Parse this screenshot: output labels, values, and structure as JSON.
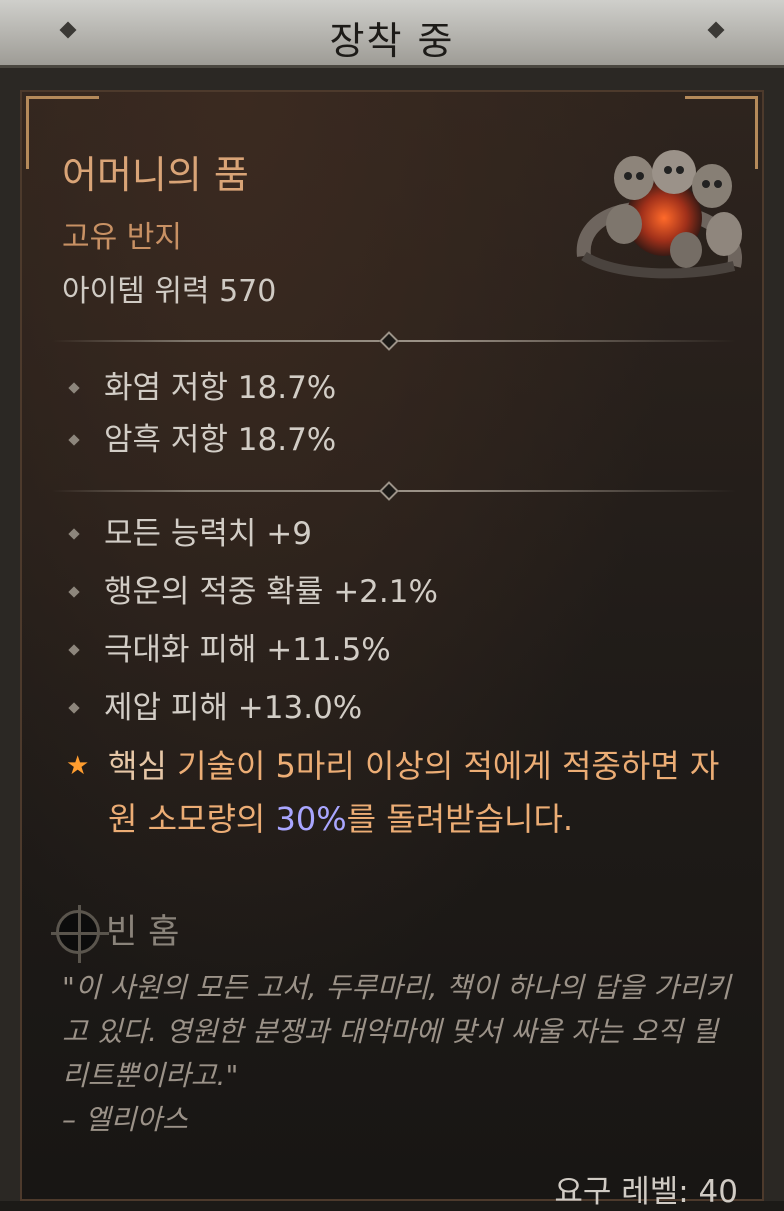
{
  "header": {
    "title": "장착 중"
  },
  "item": {
    "name": "어머니의 품",
    "type": "고유 반지",
    "power": "아이템 위력 570",
    "icon": "skull-ring-icon"
  },
  "implicit_stats": [
    {
      "label": "화염 저항 18.7%"
    },
    {
      "label": "암흑 저항 18.7%"
    }
  ],
  "affixes": [
    {
      "label": "모든 능력치 +9"
    },
    {
      "label": "행운의 적중 확률 +2.1%"
    },
    {
      "label": "극대화 피해 +11.5%"
    },
    {
      "label": "제압 피해 +13.0%"
    }
  ],
  "unique_effect": {
    "keyword": "핵심",
    "part1": " 기술이 5마리 이상의 적에게 적중하면 자원 소모량의 ",
    "value": "30%",
    "part2": "를 돌려받습니다."
  },
  "socket": {
    "label": "빈 홈"
  },
  "flavor": {
    "quote": "\"이 사원의 모든 고서, 두루마리, 책이 하나의 답을 가리키고 있다. 영원한 분쟁과 대악마에 맞서 싸울 자는 오직 릴리트뿐이라고.\"",
    "attribution": "– 엘리아스"
  },
  "requirement": {
    "label": "요구 레벨: 40"
  },
  "colors": {
    "unique_name": "#d9a477",
    "affix_text": "#d2cdc6",
    "unique_effect": "#ecad75",
    "highlight_value": "#a9a6ff",
    "star": "#ff9d2f"
  }
}
